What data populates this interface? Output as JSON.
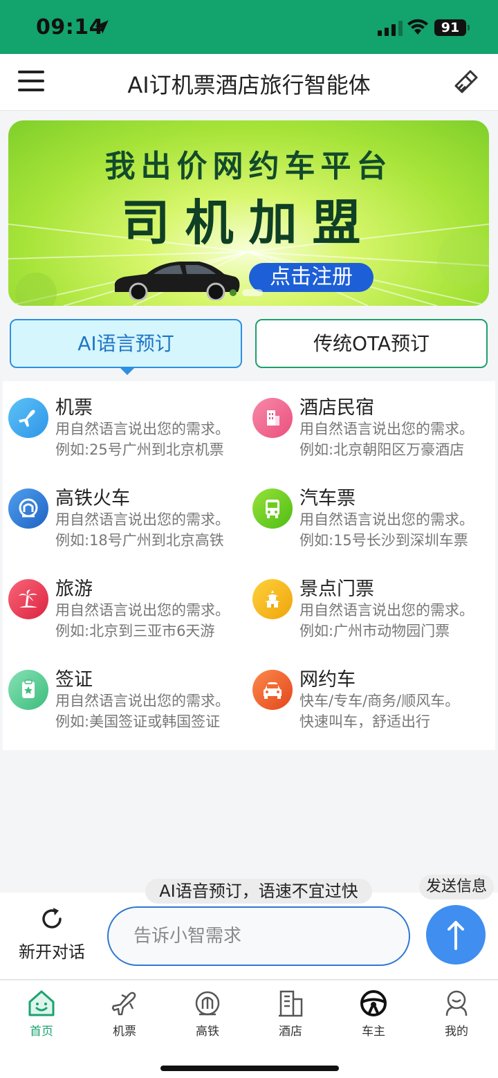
{
  "status_bar": {
    "time": "09:14",
    "battery": "91"
  },
  "header": {
    "title": "AI订机票酒店旅行智能体"
  },
  "banner": {
    "line1": "我出价网约车平台",
    "line2": "司机加盟",
    "cta": "点击注册"
  },
  "tabs": {
    "ai": "AI语言预订",
    "ota": "传统OTA预订"
  },
  "services": [
    {
      "title": "机票",
      "desc1": "用自然语言说出您的需求。",
      "desc2": "例如:25号广州到北京机票",
      "icon": "airplane-icon",
      "color": "#35a8ee"
    },
    {
      "title": "酒店民宿",
      "desc1": "用自然语言说出您的需求。",
      "desc2": "例如:北京朝阳区万豪酒店",
      "icon": "building-icon",
      "color": "#f2628e"
    },
    {
      "title": "高铁火车",
      "desc1": "用自然语言说出您的需求。",
      "desc2": "例如:18号广州到北京高铁",
      "icon": "train-icon",
      "color": "#2f7fd8"
    },
    {
      "title": "汽车票",
      "desc1": "用自然语言说出您的需求。",
      "desc2": "例如:15号长沙到深圳车票",
      "icon": "bus-icon",
      "color": "#6ccd1f"
    },
    {
      "title": "旅游",
      "desc1": "用自然语言说出您的需求。",
      "desc2": "例如:北京到三亚市6天游",
      "icon": "palm-tree-icon",
      "color": "#ee3a55"
    },
    {
      "title": "景点门票",
      "desc1": "用自然语言说出您的需求。",
      "desc2": "例如:广州市动物园门票",
      "icon": "pagoda-icon",
      "color": "#f3b91c"
    },
    {
      "title": "签证",
      "desc1": "用自然语言说出您的需求。",
      "desc2": "例如:美国签证或韩国签证",
      "icon": "visa-icon",
      "color": "#5ecf96"
    },
    {
      "title": "网约车",
      "desc1": "快车/专车/商务/顺风车。",
      "desc2": "快速叫车，舒适出行",
      "icon": "car-icon",
      "color": "#f2622a"
    }
  ],
  "hints": {
    "voice_tip": "AI语音预订，语速不宜过快",
    "send_tip": "发送信息"
  },
  "chat": {
    "new_chat_label": "新开对话",
    "input_placeholder": "告诉小智需求"
  },
  "tab_bar": [
    {
      "label": "首页",
      "icon": "home-icon",
      "active": true
    },
    {
      "label": "机票",
      "icon": "airplane-icon",
      "active": false
    },
    {
      "label": "高铁",
      "icon": "train-icon",
      "active": false
    },
    {
      "label": "酒店",
      "icon": "hotel-icon",
      "active": false
    },
    {
      "label": "车主",
      "icon": "steering-wheel-icon",
      "active": false
    },
    {
      "label": "我的",
      "icon": "user-icon",
      "active": false
    }
  ],
  "colors": {
    "brand_green": "#13a36c",
    "accent_blue": "#3f8ef0",
    "active_tab": "#1aa36f"
  }
}
